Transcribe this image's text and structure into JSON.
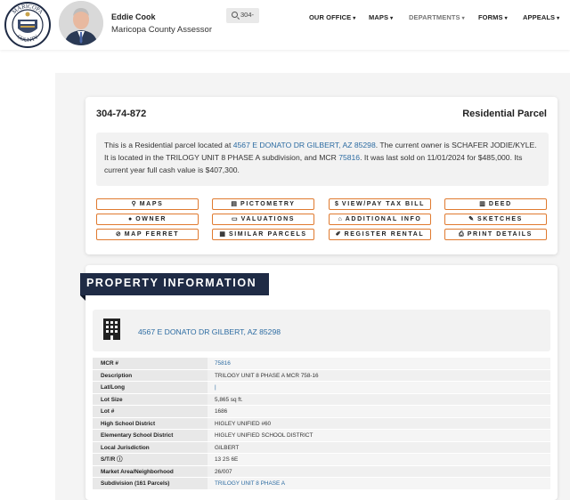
{
  "header": {
    "seal_text_top": "MARICOPA",
    "seal_text_bottom": "COUNTY",
    "assessor_name": "Eddie Cook",
    "assessor_title": "Maricopa County Assessor",
    "search_value": "304-",
    "nav": [
      {
        "label": "OUR OFFICE"
      },
      {
        "label": "MAPS"
      },
      {
        "label": "DEPARTMENTS"
      },
      {
        "label": "FORMS"
      },
      {
        "label": "APPEALS"
      }
    ]
  },
  "parcel": {
    "number": "304-74-872",
    "type": "Residential Parcel",
    "summary": {
      "p1": "This is a Residential parcel located at ",
      "address_link": "4567 E DONATO DR GILBERT, AZ 85298",
      "p2": ". The current owner is SCHAFER JODIE/KYLE. It is located in the TRILOGY UNIT 8 PHASE A subdivision, and MCR ",
      "mcr_link": "75816",
      "p3": ". It was last sold on 11/01/2024 for $485,000. Its current year full cash value is $407,300."
    }
  },
  "buttons": [
    {
      "label": "MAPS",
      "icon": "map-pin-icon",
      "glyph": "⚲"
    },
    {
      "label": "PICTOMETRY",
      "icon": "document-icon",
      "glyph": "▤"
    },
    {
      "label": "VIEW/PAY TAX BILL",
      "icon": "dollar-icon",
      "glyph": "$"
    },
    {
      "label": "DEED",
      "icon": "deed-icon",
      "glyph": "▥"
    },
    {
      "label": "OWNER",
      "icon": "user-icon",
      "glyph": "●"
    },
    {
      "label": "VALUATIONS",
      "icon": "money-icon",
      "glyph": "▭"
    },
    {
      "label": "ADDITIONAL INFO",
      "icon": "home-icon",
      "glyph": "⌂"
    },
    {
      "label": "SKETCHES",
      "icon": "sketch-icon",
      "glyph": "✎"
    },
    {
      "label": "MAP FERRET",
      "icon": "compass-icon",
      "glyph": "⊘"
    },
    {
      "label": "SIMILAR PARCELS",
      "icon": "bar-chart-icon",
      "glyph": "▦"
    },
    {
      "label": "REGISTER RENTAL",
      "icon": "edit-icon",
      "glyph": "✐"
    },
    {
      "label": "PRINT DETAILS",
      "icon": "print-icon",
      "glyph": "⎙"
    }
  ],
  "property_info": {
    "heading": "PROPERTY INFORMATION",
    "address": "4567 E DONATO DR GILBERT, AZ 85298",
    "rows": [
      {
        "key": "MCR #",
        "value": "75816",
        "link": true
      },
      {
        "key": "Description",
        "value": "TRILOGY UNIT 8 PHASE A MCR 758-16",
        "link": false
      },
      {
        "key": "Lat/Long",
        "value": "|",
        "link": true
      },
      {
        "key": "Lot Size",
        "value": "5,865 sq ft.",
        "link": false
      },
      {
        "key": "Lot #",
        "value": "1686",
        "link": false
      },
      {
        "key": "High School District",
        "value": "HIGLEY UNIFIED #60",
        "link": false
      },
      {
        "key": "Elementary School District",
        "value": "HIGLEY UNIFIED SCHOOL DISTRICT",
        "link": false
      },
      {
        "key": "Local Jurisdiction",
        "value": "GILBERT",
        "link": false
      },
      {
        "key": "S/T/R ⓘ",
        "value": "13 2S 6E",
        "link": false
      },
      {
        "key": "Market Area/Neighborhood",
        "value": "26/007",
        "link": false
      },
      {
        "key": "Subdivision (161 Parcels)",
        "value": "TRILOGY UNIT 8 PHASE A",
        "link": true
      }
    ]
  },
  "colors": {
    "accent": "#e07a2f",
    "link": "#2d6ca2",
    "banner": "#1f2b45"
  }
}
